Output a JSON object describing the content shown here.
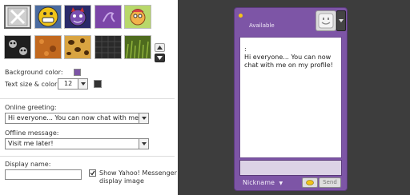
{
  "settings": {
    "background_color_label": "Background color:",
    "text_size_color_label": "Text size & color:",
    "text_size_value": "12",
    "online_greeting_label": "Online greeting:",
    "online_greeting_value": "Hi everyone... You can now chat with me on r",
    "offline_message_label": "Offline message:",
    "offline_message_value": "Visit me later!",
    "display_name_label": "Display name:",
    "display_name_value": "",
    "show_image_label_line1": "Show Yahoo! Messenger",
    "show_image_label_line2": "display image",
    "show_image_checked": true,
    "background_color": "#7d55a6",
    "text_color": "#333333"
  },
  "preview": {
    "status": "Available",
    "message_prefix": ":",
    "message": "Hi everyone... You can now chat with me on my profile!",
    "nickname": "Nickname",
    "send_label": "Send"
  }
}
